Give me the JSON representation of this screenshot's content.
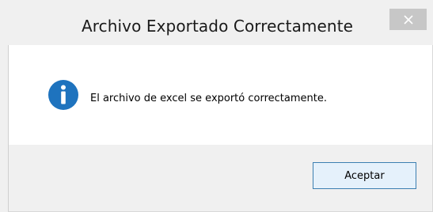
{
  "window": {
    "title": "Archivo Exportado Correctamente",
    "close_icon": "close-icon"
  },
  "content": {
    "icon": "info-icon",
    "message": "El archivo de excel se exportó correctamente."
  },
  "footer": {
    "ok_label": "Aceptar"
  },
  "colors": {
    "info_icon": "#1e73be",
    "close_button_bg": "#c7c7c7",
    "ok_button_border": "#3c7fb1",
    "ok_button_bg": "#e5f1fb"
  }
}
